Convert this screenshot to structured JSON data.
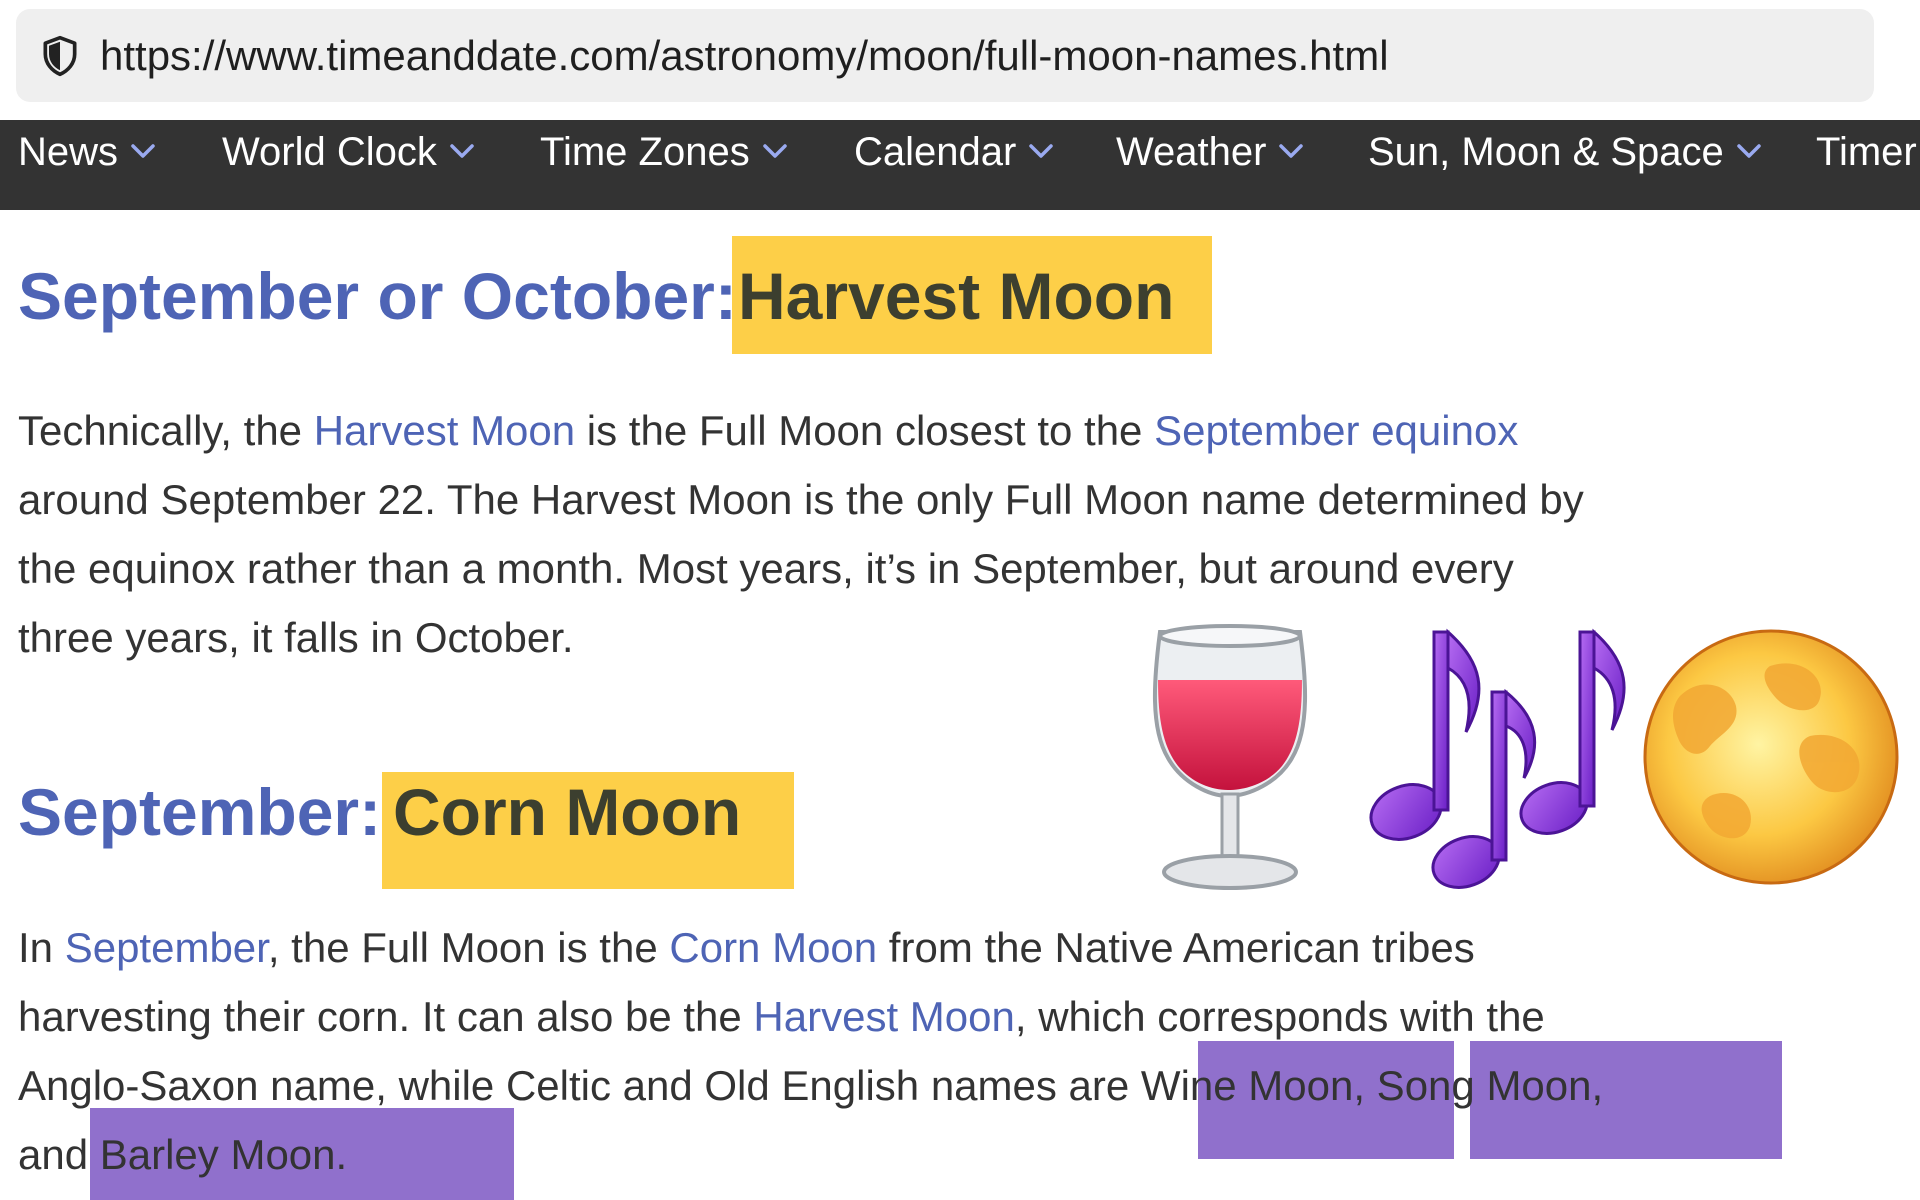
{
  "browser": {
    "url": "https://www.timeanddate.com/astronomy/moon/full-moon-names.html"
  },
  "nav": {
    "items": [
      {
        "label": "News"
      },
      {
        "label": "World Clock"
      },
      {
        "label": "Time Zones"
      },
      {
        "label": "Calendar"
      },
      {
        "label": "Weather"
      },
      {
        "label": "Sun, Moon & Space"
      },
      {
        "label": "Timer"
      }
    ]
  },
  "section_harvest": {
    "heading_prefix": "September or October:",
    "heading_name": "Harvest Moon",
    "p1_a": "Technically, the ",
    "p1_link1": "Harvest Moon",
    "p1_b": " is the Full Moon closest to the ",
    "p1_link2": "September equinox",
    "p1_line2": "around September 22. The Harvest Moon is the only Full Moon name determined by",
    "p1_line3": "the equinox rather than a month. Most years, it’s in September, but around every",
    "p1_line4": "three years, it falls in October."
  },
  "section_corn": {
    "heading_prefix": "September:",
    "heading_name": "Corn Moon",
    "p_a": "In ",
    "p_link1": "September",
    "p_b": ", the Full Moon is the ",
    "p_link2": "Corn Moon",
    "p_c": " from the Native American tribes",
    "p_line2_a": "harvesting their corn. It can also be the ",
    "p_link3": "Harvest Moon",
    "p_line2_b": ", which corresponds with the",
    "p_line3": "Anglo-Saxon name, while Celtic and Old English names are Wine Moon, Song Moon,",
    "p_line4": "and Barley Moon."
  },
  "icons": [
    "wine-glass-icon",
    "musical-notes-icon",
    "full-moon-icon"
  ],
  "colors": {
    "heading_blue": "#4e64b5",
    "highlight_yellow": "#fdcf48",
    "highlight_purple": "#9070cc",
    "nav_bg": "#333333"
  }
}
